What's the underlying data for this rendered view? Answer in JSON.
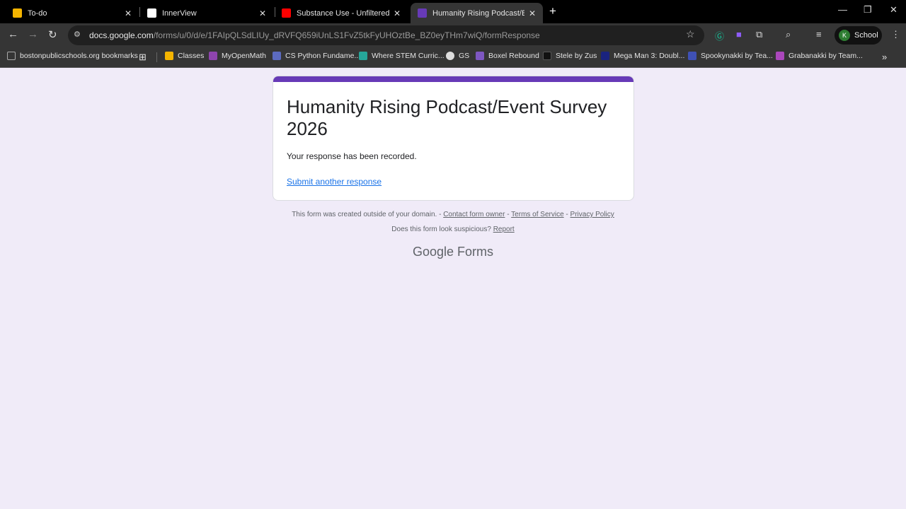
{
  "tabs": [
    {
      "title": "To-do",
      "color": "#f4b400"
    },
    {
      "title": "InnerView",
      "color": "#ffffff"
    },
    {
      "title": "Substance Use - Unfiltered Emo",
      "color": "#ff0000"
    },
    {
      "title": "Humanity Rising Podcast/Event",
      "color": "#673ab7",
      "active": true
    }
  ],
  "address": {
    "host": "docs.google.com",
    "path": "/forms/u/0/d/e/1FAIpQLSdLIUy_dRVFQ659iUnLS1FvZ5tkFyUHOztBe_BZ0eyTHm7wiQ/formResponse"
  },
  "profile": {
    "initial": "K",
    "name": "School"
  },
  "bookmarks": [
    {
      "label": "bostonpublicschools.org bookmarks",
      "color": "#888"
    },
    {
      "label": "Classes",
      "color": "#f4b400"
    },
    {
      "label": "MyOpenMath",
      "color": "#8e44ad"
    },
    {
      "label": "CS Python Fundame...",
      "color": "#5c6bc0"
    },
    {
      "label": "Where STEM Curric...",
      "color": "#26a69a"
    },
    {
      "label": "GS",
      "color": "#ddd"
    },
    {
      "label": "Boxel Rebound",
      "color": "#7e57c2"
    },
    {
      "label": "Stele by Zus",
      "color": "#222"
    },
    {
      "label": "Mega Man 3: Doubl...",
      "color": "#1a237e"
    },
    {
      "label": "Spookynakki by Tea...",
      "color": "#3f51b5"
    },
    {
      "label": "Grabanakki by Team...",
      "color": "#ab47bc"
    }
  ],
  "form": {
    "title": "Humanity Rising Podcast/Event Survey 2026",
    "message": "Your response has been recorded.",
    "submit_another": "Submit another response",
    "accent": "#673ab7"
  },
  "footer": {
    "notice": "This form was created outside of your domain. -",
    "contact": "Contact form owner",
    "terms": "Terms of Service",
    "privacy": "Privacy Policy",
    "suspicious": "Does this form look suspicious?",
    "report": "Report",
    "brand_google": "Google",
    "brand_forms": "Forms"
  }
}
